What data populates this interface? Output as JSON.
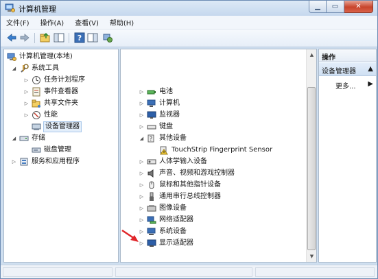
{
  "window": {
    "title": "计算机管理"
  },
  "colors": {
    "accent": "#3a75c4",
    "arrow": "#e0262a"
  },
  "menu": [
    "文件(F)",
    "操作(A)",
    "查看(V)",
    "帮助(H)"
  ],
  "toolbar": [
    "back-icon",
    "forward-icon",
    "up-folder-icon",
    "show-tree-icon",
    "help-icon",
    "properties-icon",
    "refresh-icon"
  ],
  "left_tree": [
    {
      "label": "计算机管理(本地)",
      "icon": "computer-management-icon"
    },
    {
      "label": "系统工具",
      "icon": "tools-icon"
    },
    {
      "label": "任务计划程序",
      "icon": "clock-icon"
    },
    {
      "label": "事件查看器",
      "icon": "event-viewer-icon"
    },
    {
      "label": "共享文件夹",
      "icon": "shared-folder-icon"
    },
    {
      "label": "性能",
      "icon": "performance-icon"
    },
    {
      "label": "设备管理器",
      "icon": "device-manager-icon"
    },
    {
      "label": "存储",
      "icon": "storage-icon"
    },
    {
      "label": "磁盘管理",
      "icon": "disk-icon"
    },
    {
      "label": "服务和应用程序",
      "icon": "services-icon"
    }
  ],
  "devices": [
    {
      "label": "电池",
      "icon": "battery-icon"
    },
    {
      "label": "计算机",
      "icon": "computer-icon"
    },
    {
      "label": "监视器",
      "icon": "monitor-icon"
    },
    {
      "label": "键盘",
      "icon": "keyboard-icon"
    },
    {
      "label": "其他设备",
      "icon": "other-devices-icon"
    },
    {
      "label": "TouchStrip Fingerprint Sensor",
      "icon": "warning-device-icon"
    },
    {
      "label": "人体学输入设备",
      "icon": "hid-icon"
    },
    {
      "label": "声音、视频和游戏控制器",
      "icon": "sound-icon"
    },
    {
      "label": "鼠标和其他指针设备",
      "icon": "mouse-icon"
    },
    {
      "label": "通用串行总线控制器",
      "icon": "usb-icon"
    },
    {
      "label": "图像设备",
      "icon": "imaging-icon"
    },
    {
      "label": "网络适配器",
      "icon": "network-icon"
    },
    {
      "label": "系统设备",
      "icon": "system-device-icon"
    },
    {
      "label": "显示适配器",
      "icon": "display-adapter-icon"
    }
  ],
  "actions": {
    "header": "操作",
    "section": "设备管理器",
    "more": "更多..."
  }
}
